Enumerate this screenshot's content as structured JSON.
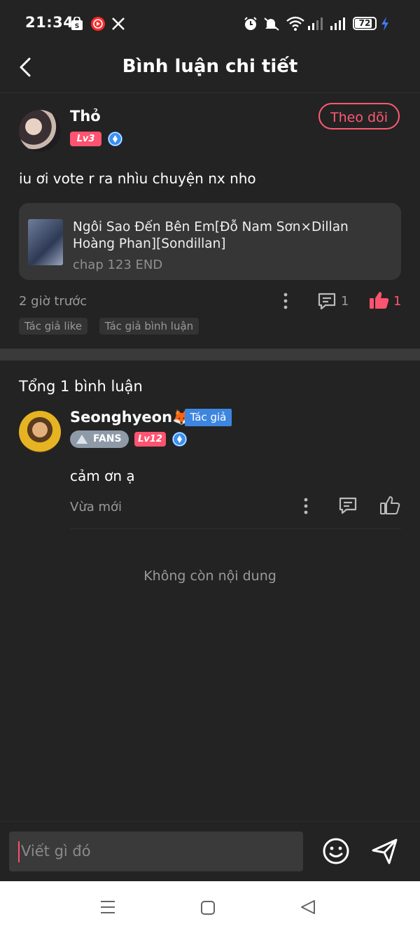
{
  "status_bar": {
    "time": "21:34",
    "battery": "72"
  },
  "header": {
    "title": "Bình luận chi tiết"
  },
  "post": {
    "username": "Thỏ",
    "level": "Lv3",
    "follow_label": "Theo dõi",
    "content": "iu ơi vote r ra nhìu chuyện nx nho",
    "story": {
      "title": "Ngôi Sao Đến Bên Em[Đỗ Nam Sơn×Dillan Hoàng Phan][Sondillan]",
      "chapter": "chap 123 END"
    },
    "time": "2 giờ trước",
    "comment_count": "1",
    "like_count": "1",
    "tags": [
      "Tác giả like",
      "Tác giả bình luận"
    ]
  },
  "replies_section": {
    "total_label": "Tổng 1 bình luận"
  },
  "reply": {
    "username": "Seonghyeon🦊",
    "author_badge": "Tác giả",
    "fans_badge": "FANS",
    "level": "Lv12",
    "content": "cảm ơn ạ",
    "time": "Vừa mới"
  },
  "end_text": "Không còn nội dung",
  "composer": {
    "placeholder": "Viết gì đó"
  },
  "colors": {
    "background": "#232323",
    "accent": "#ff5470",
    "author_badge": "#3d86e0"
  }
}
